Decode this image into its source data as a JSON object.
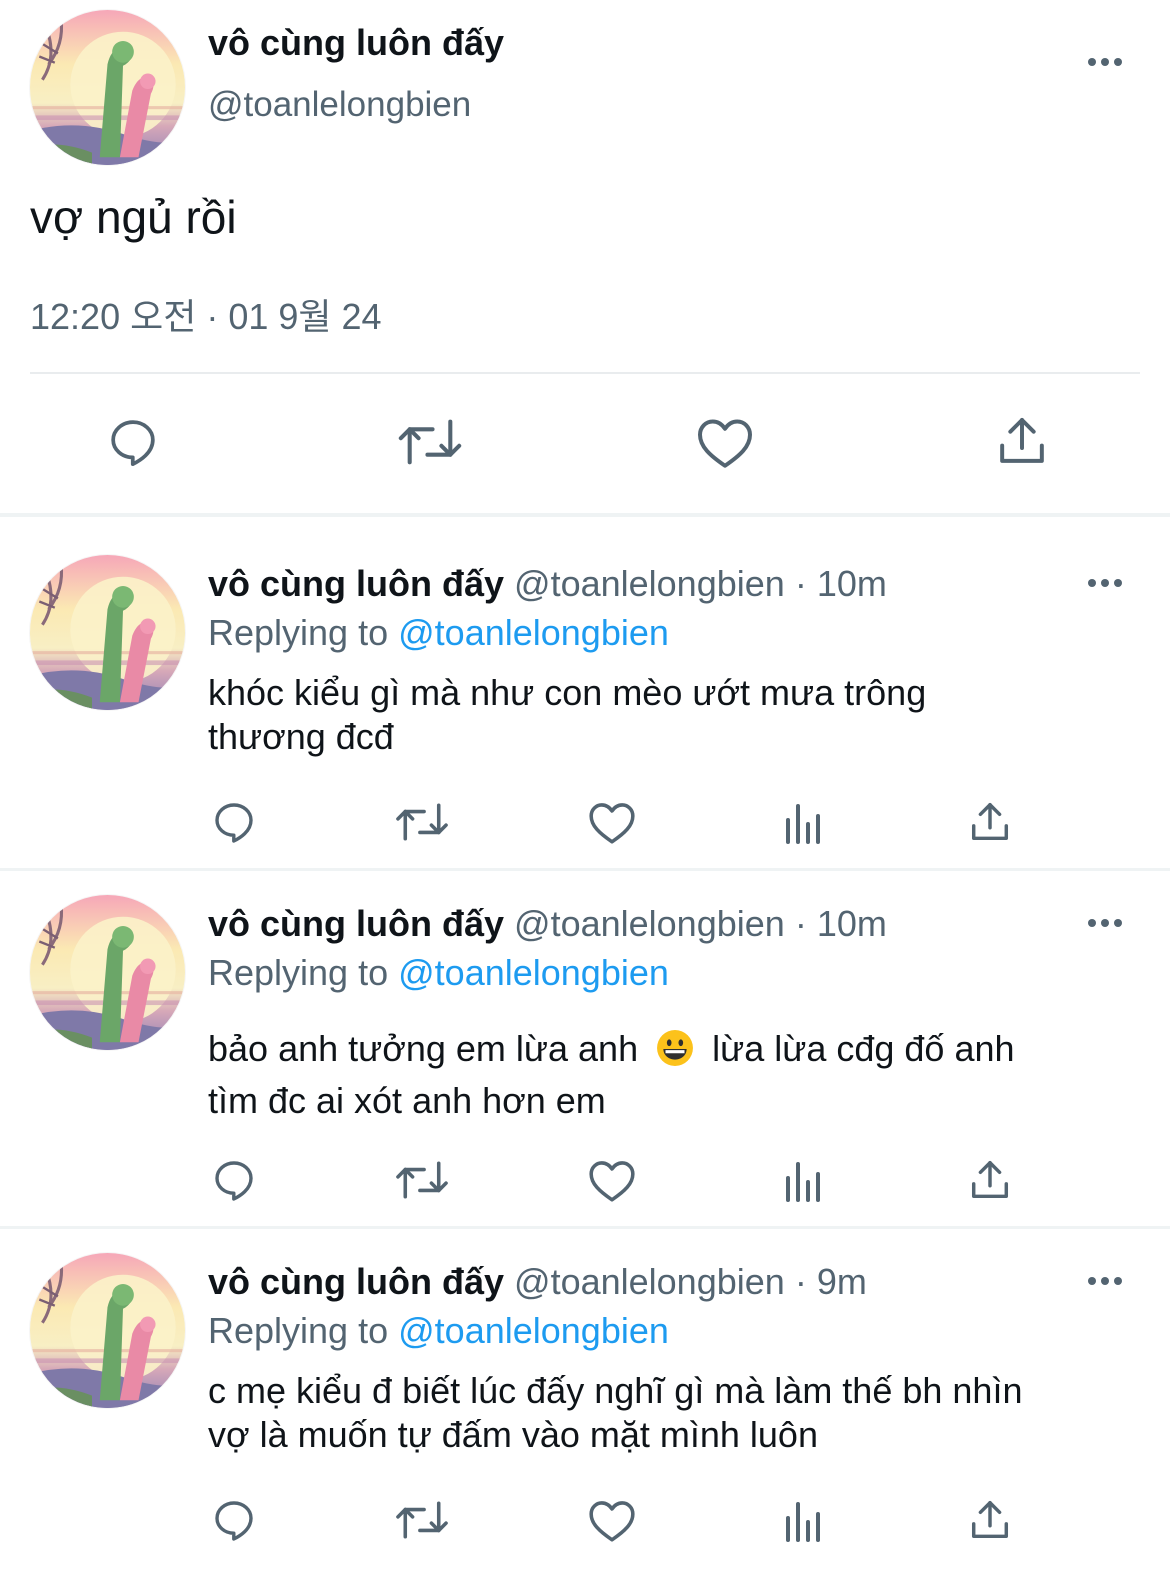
{
  "main": {
    "name": "vô cùng luôn đấy",
    "handle": "@toanlelongbien",
    "text": "vợ ngủ rồi",
    "meta": "12:20 오전 · 01 9월 24"
  },
  "replies": [
    {
      "name": "vô cùng luôn đấy",
      "handle": "@toanlelongbien",
      "dot": "·",
      "time": "10m",
      "replying_label": "Replying to",
      "mention": "@toanlelongbien",
      "text_line1": "khóc kiểu gì mà như con mèo ướt mưa trông",
      "text_line2": "thương đcđ"
    },
    {
      "name": "vô cùng luôn đấy",
      "handle": "@toanlelongbien",
      "dot": "·",
      "time": "10m",
      "replying_label": "Replying to",
      "mention": "@toanlelongbien",
      "text_before_emoji": "bảo anh tưởng em lừa anh",
      "emoji": "smiling-face-emoji",
      "text_after_emoji": "lừa lừa cđg đố anh",
      "text_line2": "tìm đc ai xót anh hơn em"
    },
    {
      "name": "vô cùng luôn đấy",
      "handle": "@toanlelongbien",
      "dot": "·",
      "time": "9m",
      "replying_label": "Replying to",
      "mention": "@toanlelongbien",
      "text_line1": "c mẹ kiểu đ biết lúc đấy nghĩ gì mà làm thế bh nhìn",
      "text_line2": "vợ là muốn tự đấm vào mặt mình luôn"
    }
  ],
  "icons": {
    "reply": "reply-bubble-icon",
    "retweet": "retweet-icon",
    "like": "heart-icon",
    "views": "bar-chart-icon",
    "share": "share-upload-icon",
    "more": "more-dots-icon"
  },
  "colors": {
    "text": "#0f1419",
    "secondary": "#536471",
    "link": "#1d9bf0",
    "divider": "#eff3f4"
  }
}
